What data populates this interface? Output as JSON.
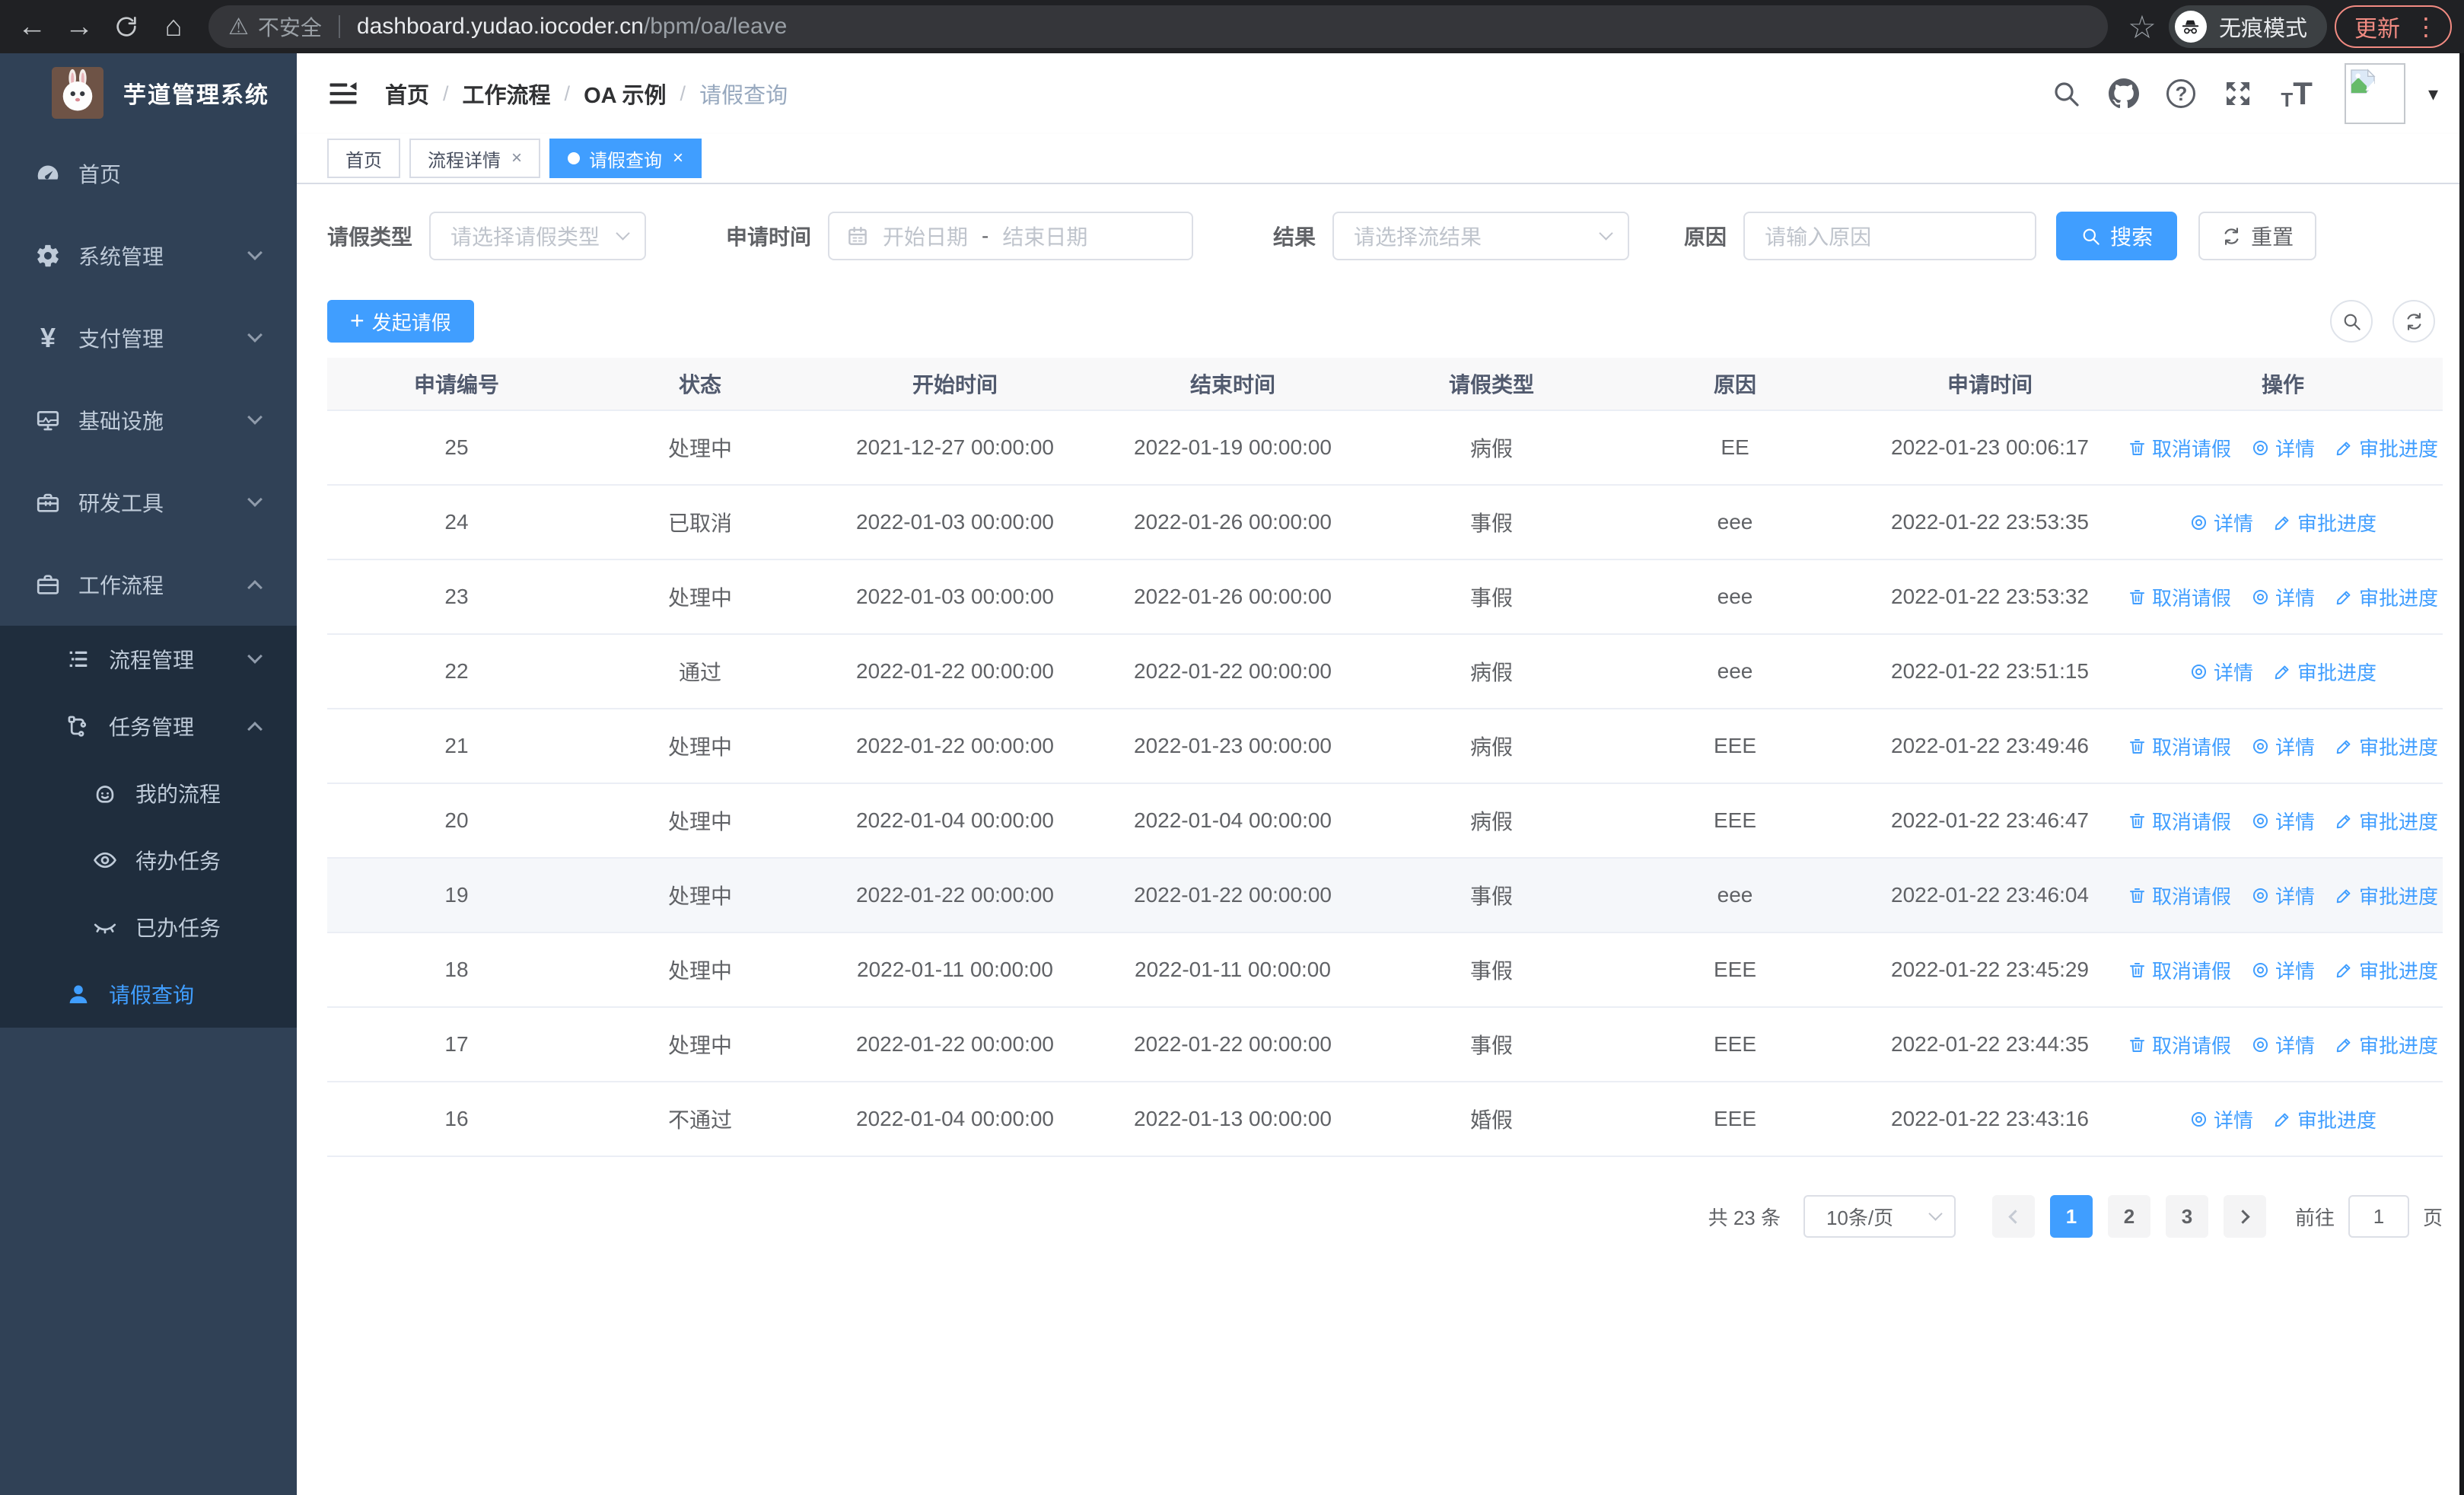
{
  "colors": {
    "primary": "#409eff",
    "sidebar_bg": "#304156",
    "sidebar_submenu_bg": "#1f2d3d",
    "sidebar_text": "#bfcbd9",
    "update_accent": "#f28b82",
    "link": "#409eff"
  },
  "browser": {
    "security_label": "不安全",
    "url_host": "dashboard.yudao.iocoder.cn",
    "url_path": "/bpm/oa/leave",
    "incognito_label": "无痕模式",
    "update_label": "更新"
  },
  "sidebar": {
    "title": "芋道管理系统",
    "items": [
      {
        "key": "home",
        "label": "首页",
        "icon": "dashboard-icon"
      },
      {
        "key": "system",
        "label": "系统管理",
        "icon": "gear-icon",
        "expandable": true
      },
      {
        "key": "payment",
        "label": "支付管理",
        "icon": "yen-icon",
        "expandable": true
      },
      {
        "key": "infrastructure",
        "label": "基础设施",
        "icon": "monitor-icon",
        "expandable": true
      },
      {
        "key": "dev-tools",
        "label": "研发工具",
        "icon": "toolbox-icon",
        "expandable": true
      },
      {
        "key": "workflow",
        "label": "工作流程",
        "icon": "briefcase-icon",
        "expandable": true,
        "expanded": true,
        "children": [
          {
            "key": "process-mgmt",
            "label": "流程管理",
            "icon": "list-icon",
            "expandable": true
          },
          {
            "key": "task-mgmt",
            "label": "任务管理",
            "icon": "flow-icon",
            "expandable": true,
            "expanded": true,
            "children": [
              {
                "key": "my-process",
                "label": "我的流程",
                "icon": "face-icon"
              },
              {
                "key": "todo-tasks",
                "label": "待办任务",
                "icon": "eye-icon"
              },
              {
                "key": "done-tasks",
                "label": "已办任务",
                "icon": "eye-closed-icon"
              }
            ]
          },
          {
            "key": "leave-query",
            "label": "请假查询",
            "icon": "user-icon",
            "active": true
          }
        ]
      }
    ]
  },
  "header": {
    "breadcrumb": [
      "首页",
      "工作流程",
      "OA 示例",
      "请假查询"
    ],
    "icons": [
      "search-icon",
      "github-icon",
      "question-icon",
      "fullscreen-icon",
      "fontsize-icon"
    ]
  },
  "tabs": [
    {
      "key": "home",
      "label": "首页"
    },
    {
      "key": "process-detail",
      "label": "流程详情",
      "closable": true
    },
    {
      "key": "leave-query",
      "label": "请假查询",
      "closable": true,
      "active": true
    }
  ],
  "filters": {
    "type": {
      "label": "请假类型",
      "placeholder": "请选择请假类型"
    },
    "time": {
      "label": "申请时间",
      "start_placeholder": "开始日期",
      "separator": "-",
      "end_placeholder": "结束日期"
    },
    "result": {
      "label": "结果",
      "placeholder": "请选择流结果"
    },
    "reason": {
      "label": "原因",
      "placeholder": "请输入原因"
    },
    "search_label": "搜索",
    "reset_label": "重置"
  },
  "toolbar": {
    "create_label": "发起请假"
  },
  "table": {
    "columns": [
      {
        "key": "id",
        "label": "申请编号"
      },
      {
        "key": "status",
        "label": "状态"
      },
      {
        "key": "start",
        "label": "开始时间"
      },
      {
        "key": "end",
        "label": "结束时间"
      },
      {
        "key": "type",
        "label": "请假类型"
      },
      {
        "key": "reason",
        "label": "原因"
      },
      {
        "key": "apply_time",
        "label": "申请时间"
      },
      {
        "key": "actions",
        "label": "操作"
      }
    ],
    "rows": [
      {
        "id": "25",
        "status": "处理中",
        "start": "2021-12-27 00:00:00",
        "end": "2022-01-19 00:00:00",
        "type": "病假",
        "reason": "EE",
        "apply_time": "2022-01-23 00:06:17",
        "actions": [
          {
            "key": "cancel",
            "label": "取消请假",
            "icon": "delete-icon"
          },
          {
            "key": "detail",
            "label": "详情",
            "icon": "view-icon"
          },
          {
            "key": "progress",
            "label": "审批进度",
            "icon": "edit-icon"
          }
        ]
      },
      {
        "id": "24",
        "status": "已取消",
        "start": "2022-01-03 00:00:00",
        "end": "2022-01-26 00:00:00",
        "type": "事假",
        "reason": "eee",
        "apply_time": "2022-01-22 23:53:35",
        "actions": [
          {
            "key": "detail",
            "label": "详情",
            "icon": "view-icon"
          },
          {
            "key": "progress",
            "label": "审批进度",
            "icon": "edit-icon"
          }
        ]
      },
      {
        "id": "23",
        "status": "处理中",
        "start": "2022-01-03 00:00:00",
        "end": "2022-01-26 00:00:00",
        "type": "事假",
        "reason": "eee",
        "apply_time": "2022-01-22 23:53:32",
        "actions": [
          {
            "key": "cancel",
            "label": "取消请假",
            "icon": "delete-icon"
          },
          {
            "key": "detail",
            "label": "详情",
            "icon": "view-icon"
          },
          {
            "key": "progress",
            "label": "审批进度",
            "icon": "edit-icon"
          }
        ]
      },
      {
        "id": "22",
        "status": "通过",
        "start": "2022-01-22 00:00:00",
        "end": "2022-01-22 00:00:00",
        "type": "病假",
        "reason": "eee",
        "apply_time": "2022-01-22 23:51:15",
        "actions": [
          {
            "key": "detail",
            "label": "详情",
            "icon": "view-icon"
          },
          {
            "key": "progress",
            "label": "审批进度",
            "icon": "edit-icon"
          }
        ]
      },
      {
        "id": "21",
        "status": "处理中",
        "start": "2022-01-22 00:00:00",
        "end": "2022-01-23 00:00:00",
        "type": "病假",
        "reason": "EEE",
        "apply_time": "2022-01-22 23:49:46",
        "actions": [
          {
            "key": "cancel",
            "label": "取消请假",
            "icon": "delete-icon"
          },
          {
            "key": "detail",
            "label": "详情",
            "icon": "view-icon"
          },
          {
            "key": "progress",
            "label": "审批进度",
            "icon": "edit-icon"
          }
        ]
      },
      {
        "id": "20",
        "status": "处理中",
        "start": "2022-01-04 00:00:00",
        "end": "2022-01-04 00:00:00",
        "type": "病假",
        "reason": "EEE",
        "apply_time": "2022-01-22 23:46:47",
        "actions": [
          {
            "key": "cancel",
            "label": "取消请假",
            "icon": "delete-icon"
          },
          {
            "key": "detail",
            "label": "详情",
            "icon": "view-icon"
          },
          {
            "key": "progress",
            "label": "审批进度",
            "icon": "edit-icon"
          }
        ]
      },
      {
        "id": "19",
        "status": "处理中",
        "start": "2022-01-22 00:00:00",
        "end": "2022-01-22 00:00:00",
        "type": "事假",
        "reason": "eee",
        "apply_time": "2022-01-22 23:46:04",
        "highlighted": true,
        "actions": [
          {
            "key": "cancel",
            "label": "取消请假",
            "icon": "delete-icon"
          },
          {
            "key": "detail",
            "label": "详情",
            "icon": "view-icon"
          },
          {
            "key": "progress",
            "label": "审批进度",
            "icon": "edit-icon"
          }
        ]
      },
      {
        "id": "18",
        "status": "处理中",
        "start": "2022-01-11 00:00:00",
        "end": "2022-01-11 00:00:00",
        "type": "事假",
        "reason": "EEE",
        "apply_time": "2022-01-22 23:45:29",
        "actions": [
          {
            "key": "cancel",
            "label": "取消请假",
            "icon": "delete-icon"
          },
          {
            "key": "detail",
            "label": "详情",
            "icon": "view-icon"
          },
          {
            "key": "progress",
            "label": "审批进度",
            "icon": "edit-icon"
          }
        ]
      },
      {
        "id": "17",
        "status": "处理中",
        "start": "2022-01-22 00:00:00",
        "end": "2022-01-22 00:00:00",
        "type": "事假",
        "reason": "EEE",
        "apply_time": "2022-01-22 23:44:35",
        "actions": [
          {
            "key": "cancel",
            "label": "取消请假",
            "icon": "delete-icon"
          },
          {
            "key": "detail",
            "label": "详情",
            "icon": "view-icon"
          },
          {
            "key": "progress",
            "label": "审批进度",
            "icon": "edit-icon"
          }
        ]
      },
      {
        "id": "16",
        "status": "不通过",
        "start": "2022-01-04 00:00:00",
        "end": "2022-01-13 00:00:00",
        "type": "婚假",
        "reason": "EEE",
        "apply_time": "2022-01-22 23:43:16",
        "actions": [
          {
            "key": "detail",
            "label": "详情",
            "icon": "view-icon"
          },
          {
            "key": "progress",
            "label": "审批进度",
            "icon": "edit-icon"
          }
        ]
      }
    ]
  },
  "pagination": {
    "total_label": "共 23 条",
    "page_size": "10条/页",
    "pages": [
      "1",
      "2",
      "3"
    ],
    "active_page": "1",
    "goto_label": "前往",
    "goto_value": "1",
    "unit_label": "页"
  }
}
